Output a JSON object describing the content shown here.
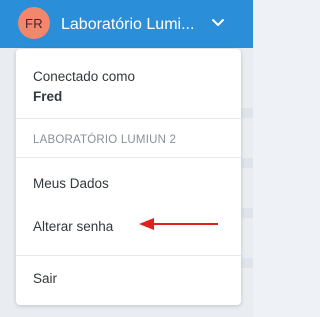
{
  "header": {
    "avatar_initials": "FR",
    "org_name": "Laboratório Lumi...",
    "chevron_icon": "chevron-down-icon",
    "bar_color": "#2a8fd8",
    "avatar_color": "#f2876b"
  },
  "dropdown": {
    "connected_label": "Conectado como",
    "user_name": "Fred",
    "lab_label": "LABORATÓRIO LUMIUN 2",
    "items": [
      {
        "label": "Meus Dados"
      },
      {
        "label": "Alterar senha"
      },
      {
        "label": "Sair"
      }
    ]
  },
  "annotation": {
    "arrow_icon": "arrow-left-icon",
    "arrow_color": "#e0211b"
  }
}
